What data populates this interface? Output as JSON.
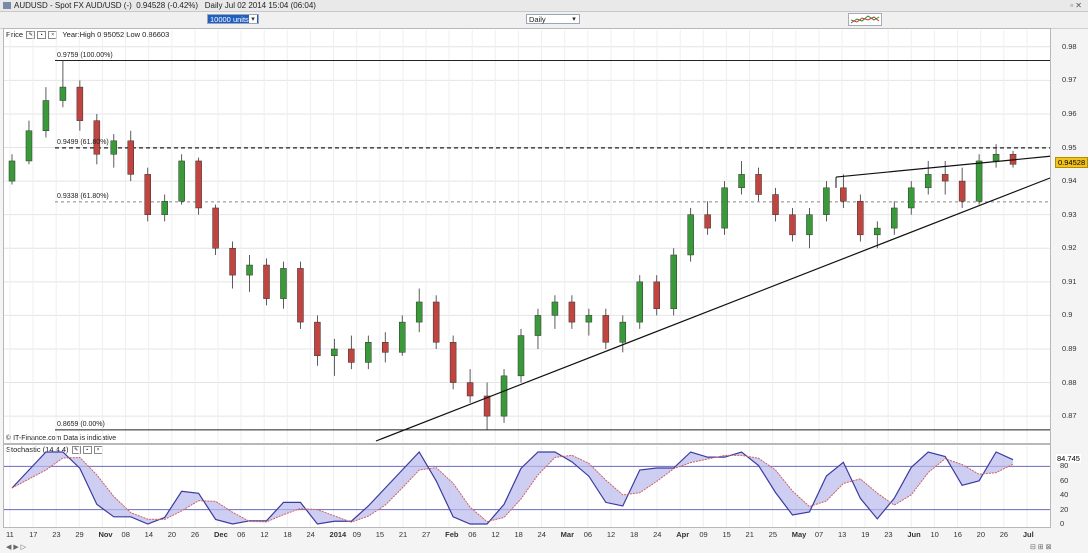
{
  "window": {
    "title": "AUDUSD - Spot FX AUD/USD (-)",
    "status": "0.94528 (-0.42%)",
    "date_info": "Daily  Jul 02 2014 15:04 (06:04)"
  },
  "toolbar": {
    "units": "10000 units",
    "period": "Daily"
  },
  "price_panel": {
    "label": "Price",
    "year_info": "Year:High 0.95052 Low 0.86603",
    "credit": "© IT-Finance.com  Data is indicative",
    "last_price": "0.94528",
    "yaxis": [
      "0.98",
      "0.97",
      "0.96",
      "0.95",
      "0.94",
      "0.93",
      "0.92",
      "0.91",
      "0.9",
      "0.89",
      "0.88",
      "0.87"
    ],
    "fib_levels": [
      {
        "label": "0.9759 (100.00%)",
        "value": 0.9759
      },
      {
        "label": "0.9499 (61.80%)",
        "value": 0.9499
      },
      {
        "label": "0.9338 (61.80%)",
        "value": 0.9338
      },
      {
        "label": "0.8659 (0.00%)",
        "value": 0.8659
      }
    ]
  },
  "stoch_panel": {
    "label": "Stochastic (14 4 4)",
    "value": "84.745",
    "yaxis": [
      "80",
      "60",
      "40",
      "20",
      "0"
    ]
  },
  "xaxis": [
    "11",
    "17",
    "23",
    "29",
    "Nov",
    "08",
    "14",
    "20",
    "26",
    "Dec",
    "06",
    "12",
    "18",
    "24",
    "2014",
    "09",
    "15",
    "21",
    "27",
    "Feb",
    "06",
    "12",
    "18",
    "24",
    "Mar",
    "06",
    "12",
    "18",
    "24",
    "Apr",
    "09",
    "15",
    "21",
    "25",
    "May",
    "07",
    "13",
    "19",
    "23",
    "Jun",
    "10",
    "16",
    "20",
    "26",
    "Jul"
  ],
  "chart_data": {
    "type": "candlestick",
    "instrument": "AUDUSD",
    "ylim": [
      0.862,
      0.985
    ],
    "candles_ohlc_sampled": [
      [
        0.94,
        0.948,
        0.939,
        0.946
      ],
      [
        0.946,
        0.958,
        0.945,
        0.955
      ],
      [
        0.955,
        0.968,
        0.953,
        0.964
      ],
      [
        0.964,
        0.976,
        0.962,
        0.968
      ],
      [
        0.968,
        0.97,
        0.955,
        0.958
      ],
      [
        0.958,
        0.96,
        0.945,
        0.948
      ],
      [
        0.948,
        0.954,
        0.944,
        0.952
      ],
      [
        0.952,
        0.955,
        0.94,
        0.942
      ],
      [
        0.942,
        0.944,
        0.928,
        0.93
      ],
      [
        0.93,
        0.936,
        0.928,
        0.934
      ],
      [
        0.934,
        0.948,
        0.933,
        0.946
      ],
      [
        0.946,
        0.947,
        0.93,
        0.932
      ],
      [
        0.932,
        0.933,
        0.918,
        0.92
      ],
      [
        0.92,
        0.922,
        0.908,
        0.912
      ],
      [
        0.912,
        0.918,
        0.907,
        0.915
      ],
      [
        0.915,
        0.917,
        0.903,
        0.905
      ],
      [
        0.905,
        0.916,
        0.902,
        0.914
      ],
      [
        0.914,
        0.916,
        0.896,
        0.898
      ],
      [
        0.898,
        0.9,
        0.885,
        0.888
      ],
      [
        0.888,
        0.893,
        0.882,
        0.89
      ],
      [
        0.89,
        0.894,
        0.884,
        0.886
      ],
      [
        0.886,
        0.894,
        0.884,
        0.892
      ],
      [
        0.892,
        0.895,
        0.886,
        0.889
      ],
      [
        0.889,
        0.9,
        0.888,
        0.898
      ],
      [
        0.898,
        0.908,
        0.895,
        0.904
      ],
      [
        0.904,
        0.906,
        0.89,
        0.892
      ],
      [
        0.892,
        0.894,
        0.878,
        0.88
      ],
      [
        0.88,
        0.884,
        0.874,
        0.876
      ],
      [
        0.876,
        0.88,
        0.866,
        0.87
      ],
      [
        0.87,
        0.884,
        0.868,
        0.882
      ],
      [
        0.882,
        0.896,
        0.88,
        0.894
      ],
      [
        0.894,
        0.902,
        0.89,
        0.9
      ],
      [
        0.9,
        0.906,
        0.896,
        0.904
      ],
      [
        0.904,
        0.906,
        0.896,
        0.898
      ],
      [
        0.898,
        0.902,
        0.894,
        0.9
      ],
      [
        0.9,
        0.902,
        0.89,
        0.892
      ],
      [
        0.892,
        0.9,
        0.889,
        0.898
      ],
      [
        0.898,
        0.912,
        0.896,
        0.91
      ],
      [
        0.91,
        0.912,
        0.9,
        0.902
      ],
      [
        0.902,
        0.92,
        0.9,
        0.918
      ],
      [
        0.918,
        0.932,
        0.916,
        0.93
      ],
      [
        0.93,
        0.934,
        0.924,
        0.926
      ],
      [
        0.926,
        0.94,
        0.924,
        0.938
      ],
      [
        0.938,
        0.946,
        0.936,
        0.942
      ],
      [
        0.942,
        0.944,
        0.934,
        0.936
      ],
      [
        0.936,
        0.938,
        0.928,
        0.93
      ],
      [
        0.93,
        0.932,
        0.922,
        0.924
      ],
      [
        0.924,
        0.932,
        0.92,
        0.93
      ],
      [
        0.93,
        0.94,
        0.928,
        0.938
      ],
      [
        0.938,
        0.942,
        0.932,
        0.934
      ],
      [
        0.934,
        0.936,
        0.922,
        0.924
      ],
      [
        0.924,
        0.928,
        0.92,
        0.926
      ],
      [
        0.926,
        0.934,
        0.924,
        0.932
      ],
      [
        0.932,
        0.94,
        0.93,
        0.938
      ],
      [
        0.938,
        0.946,
        0.936,
        0.942
      ],
      [
        0.942,
        0.946,
        0.936,
        0.94
      ],
      [
        0.94,
        0.944,
        0.932,
        0.934
      ],
      [
        0.934,
        0.948,
        0.933,
        0.946
      ],
      [
        0.946,
        0.951,
        0.944,
        0.948
      ],
      [
        0.948,
        0.949,
        0.944,
        0.945
      ]
    ]
  }
}
